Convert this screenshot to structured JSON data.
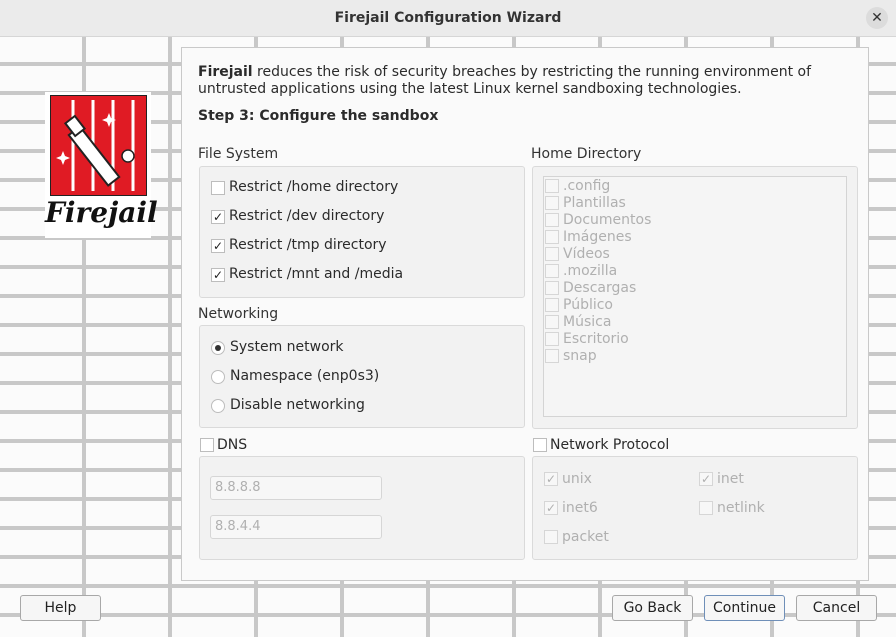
{
  "window": {
    "title": "Firejail Configuration Wizard",
    "close_glyph": "✕"
  },
  "logo": {
    "text": "Firejail"
  },
  "intro": {
    "bold": "Firejail",
    "rest": " reduces the risk of security breaches by restricting the running environment of untrusted applications using the latest Linux kernel sandboxing technologies."
  },
  "step": "Step 3: Configure the sandbox",
  "file_system": {
    "label": "File System",
    "items": [
      {
        "label": "Restrict /home directory",
        "checked": false
      },
      {
        "label": "Restrict /dev directory",
        "checked": true
      },
      {
        "label": "Restrict /tmp directory",
        "checked": true
      },
      {
        "label": "Restrict /mnt and /media",
        "checked": true
      }
    ]
  },
  "networking": {
    "label": "Networking",
    "options": [
      {
        "label": "System network",
        "selected": true
      },
      {
        "label": "Namespace (enp0s3)",
        "selected": false
      },
      {
        "label": "Disable networking",
        "selected": false
      }
    ]
  },
  "dns": {
    "label": "DNS",
    "checked": false,
    "servers": [
      "8.8.8.8",
      "8.8.4.4"
    ]
  },
  "home_directory": {
    "label": "Home Directory",
    "items": [
      ".config",
      "Plantillas",
      "Documentos",
      "Imágenes",
      "Vídeos",
      ".mozilla",
      "Descargas",
      "Público",
      "Música",
      "Escritorio",
      "snap"
    ]
  },
  "network_protocol": {
    "label": "Network Protocol",
    "checked": false,
    "items": [
      {
        "label": "unix",
        "checked": true
      },
      {
        "label": "inet",
        "checked": true
      },
      {
        "label": "inet6",
        "checked": true
      },
      {
        "label": "netlink",
        "checked": false
      },
      {
        "label": "packet",
        "checked": false
      }
    ]
  },
  "buttons": {
    "help": "Help",
    "go_back": "Go Back",
    "continue": "Continue",
    "cancel": "Cancel"
  },
  "check_glyph": "✓"
}
